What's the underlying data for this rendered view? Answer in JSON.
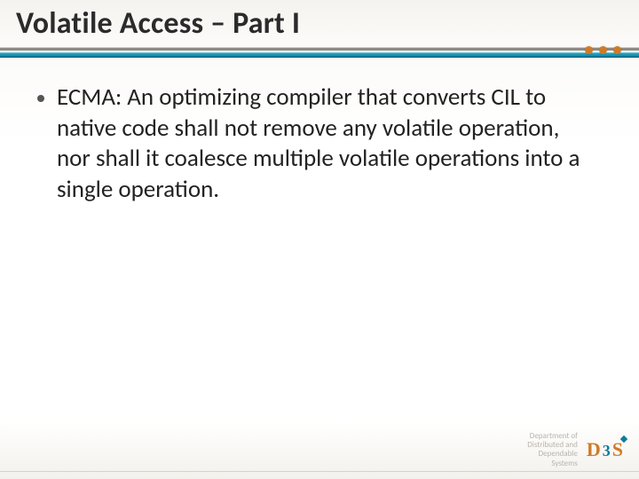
{
  "title": "Volatile Access – Part I",
  "bullets": [
    "ECMA: An optimizing compiler that converts CIL to native code shall not remove any volatile operation, nor shall it coalesce multiple volatile operations into a single operation."
  ],
  "footer": {
    "dept_line1": "Department of",
    "dept_line2": "Distributed and",
    "dept_line3": "Dependable",
    "dept_line4": "Systems",
    "logo_d": "D",
    "logo_3": "3",
    "logo_s": "S"
  },
  "colors": {
    "accent_teal": "#0f7c99",
    "accent_orange": "#d07a28"
  }
}
